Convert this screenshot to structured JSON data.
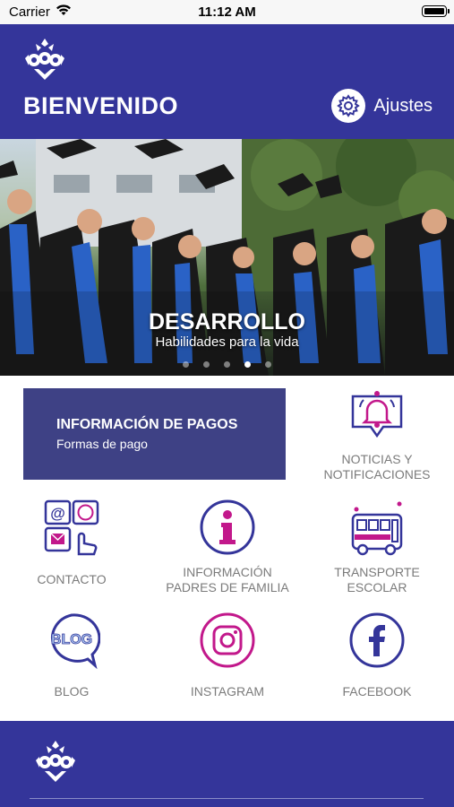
{
  "status_bar": {
    "carrier": "Carrier",
    "time": "11:12 AM"
  },
  "header": {
    "title": "BIENVENIDO",
    "settings_label": "Ajustes",
    "background": "#34359a"
  },
  "banner": {
    "title": "DESARROLLO",
    "subtitle": "Habilidades para la vida",
    "slide_count": 5,
    "active_slide": 3
  },
  "payments_card": {
    "title": "INFORMACIÓN DE PAGOS",
    "subtitle": "Formas de pago",
    "background": "#3e4185"
  },
  "tiles": {
    "news": {
      "label_1": "NOTICIAS Y",
      "label_2": "NOTIFICACIONES",
      "icon": "bell-icon"
    },
    "contact": {
      "label": "CONTACTO",
      "icon": "contact-icon"
    },
    "parents": {
      "label_1": "INFORMACIÓN",
      "label_2": "PADRES DE FAMILIA",
      "icon": "info-icon"
    },
    "transport": {
      "label_1": "TRANSPORTE",
      "label_2": "ESCOLAR",
      "icon": "bus-icon"
    },
    "blog": {
      "label": "BLOG",
      "icon_text": "BLOG",
      "icon": "blog-bubble-icon"
    },
    "instagram": {
      "label": "INSTAGRAM",
      "icon": "instagram-icon"
    },
    "facebook": {
      "label": "FACEBOOK",
      "icon": "facebook-icon"
    }
  },
  "colors": {
    "brand_blue": "#34359a",
    "accent_magenta": "#c2188b",
    "label_gray": "#7b7b7b"
  }
}
